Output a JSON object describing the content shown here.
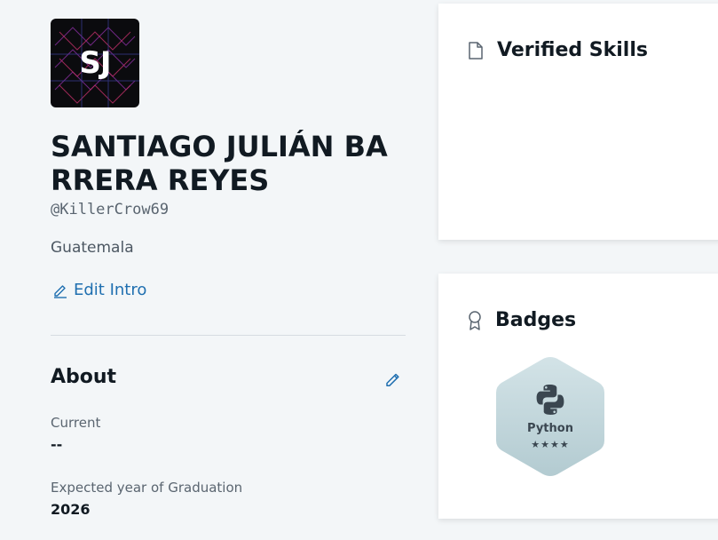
{
  "profile": {
    "initials": "SJ",
    "name": "SANTIAGO JULIÁN BARRERA REYES",
    "handle": "@KillerCrow69",
    "location": "Guatemala",
    "edit_intro_label": "Edit Intro"
  },
  "about": {
    "title": "About",
    "fields": [
      {
        "label": "Current",
        "value": "--"
      },
      {
        "label": "Expected year of Graduation",
        "value": "2026"
      }
    ]
  },
  "verified_skills": {
    "title": "Verified Skills"
  },
  "badges": {
    "title": "Badges",
    "items": [
      {
        "name": "Python",
        "stars": 4,
        "stars_text": "★★★★",
        "icon": "python-icon"
      }
    ]
  },
  "colors": {
    "accent": "#1f6fb0",
    "background": "#f3f6f8",
    "badge_fill": "#c3d6db"
  }
}
